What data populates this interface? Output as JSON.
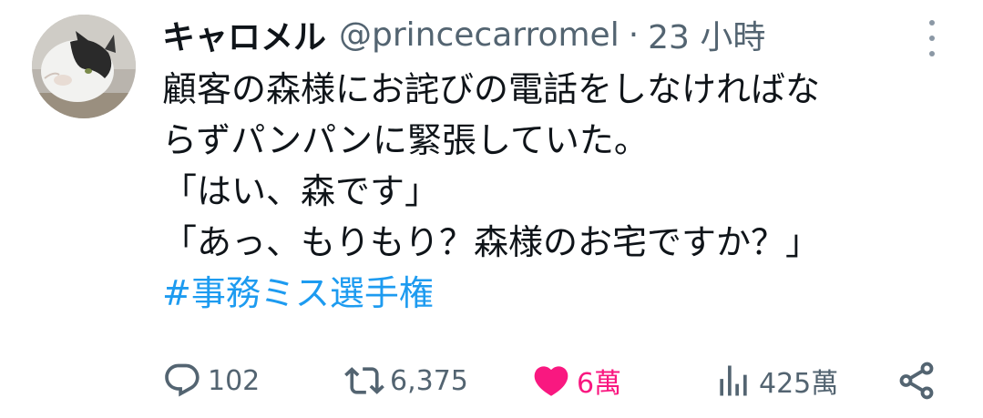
{
  "tweet": {
    "author": {
      "display_name": "キャロメル",
      "handle": "@princecarromel",
      "separator": "·",
      "time": "23 小時"
    },
    "text_lines": [
      "顧客の森様にお詫びの電話をしなければな",
      "らずパンパンに緊張していた。",
      "「はい、森です」",
      "「あっ、もりもり？森様のお宅ですか？」"
    ],
    "hashtag": "#事務ミス選手権",
    "actions": {
      "reply": {
        "icon": "reply-icon",
        "count": "102"
      },
      "retweet": {
        "icon": "retweet-icon",
        "count": "6,375"
      },
      "like": {
        "icon": "heart-icon",
        "count": "6萬",
        "color": "#f91880"
      },
      "views": {
        "icon": "views-icon",
        "count": "425萬"
      },
      "share": {
        "icon": "share-icon"
      }
    },
    "colors": {
      "text": "#0f1419",
      "secondary": "#536471",
      "link": "#1d9bf0",
      "like": "#f91880"
    }
  }
}
